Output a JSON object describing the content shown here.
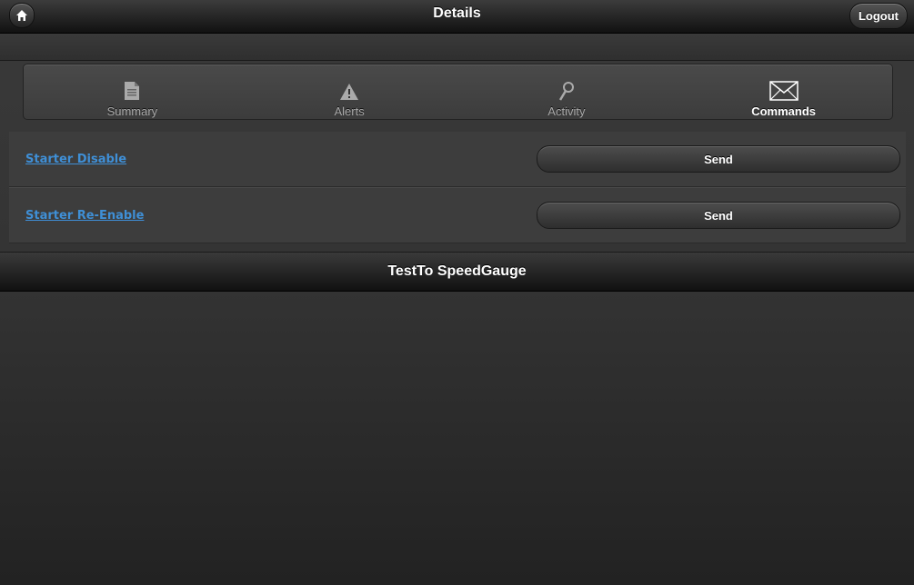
{
  "header": {
    "title": "Details",
    "home_icon": "home-icon",
    "logout_label": "Logout"
  },
  "tabs": [
    {
      "label": "Summary",
      "icon": "document-icon",
      "active": false
    },
    {
      "label": "Alerts",
      "icon": "warning-icon",
      "active": false
    },
    {
      "label": "Activity",
      "icon": "magnifier-icon",
      "active": false
    },
    {
      "label": "Commands",
      "icon": "envelope-icon",
      "active": true
    }
  ],
  "commands": [
    {
      "label": "Starter Disable",
      "button_label": "Send"
    },
    {
      "label": "Starter Re-Enable",
      "button_label": "Send"
    }
  ],
  "footer": {
    "text": "TestTo SpeedGauge"
  },
  "colors": {
    "link": "#3f8fd6",
    "background": "#333333"
  }
}
